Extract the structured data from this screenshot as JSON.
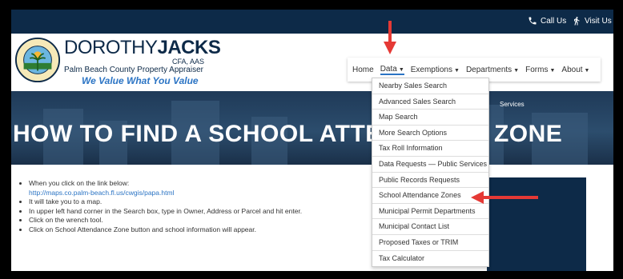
{
  "topbar": {
    "call_label": "Call Us",
    "visit_label": "Visit Us"
  },
  "brand": {
    "name_light": "DOROTHY",
    "name_bold": "JACKS",
    "credentials": "CFA, AAS",
    "org": "Palm Beach County Property Appraiser",
    "tagline": "We Value What You Value",
    "seal_text": "PALM BEACH COUNTY PROPERTY APPRAISER"
  },
  "nav": {
    "items": [
      {
        "label": "Home"
      },
      {
        "label": "Data"
      },
      {
        "label": "Exemptions"
      },
      {
        "label": "Departments"
      },
      {
        "label": "Forms"
      },
      {
        "label": "About"
      }
    ]
  },
  "dropdown": {
    "items": [
      "Nearby Sales Search",
      "Advanced Sales Search",
      "Map Search",
      "More Search Options",
      "Tax Roll Information",
      "Data Requests — Public Services",
      "Public Records Requests",
      "School Attendance Zones",
      "Municipal Permit Departments",
      "Municipal Contact List",
      "Proposed Taxes or TRIM",
      "Tax Calculator"
    ]
  },
  "hero": {
    "title": "HOW TO FIND A SCHOOL ATTENDANCE ZONE"
  },
  "content": {
    "step1": "When you click on the link below:",
    "link": "http://maps.co.palm-beach.fl.us/cwgis/papa.html",
    "step2": "It will take you to a map.",
    "step3": "In upper left hand corner in the Search box, type in Owner, Address or Parcel and hit enter.",
    "step4": "Click on the wrench tool.",
    "step5": "Click on School Attendance Zone button and school information will appear."
  },
  "sidebox": {
    "label": "Services"
  },
  "colors": {
    "navy": "#0d2a48",
    "accent": "#2b74c4",
    "arrow": "#e53935"
  }
}
